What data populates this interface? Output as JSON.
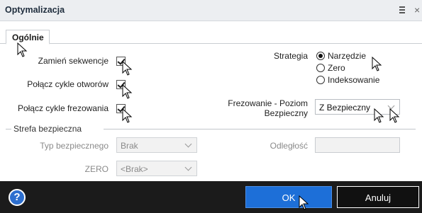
{
  "window": {
    "title": "Optymalizacja",
    "close_glyph": "×"
  },
  "tabs": [
    {
      "label": "Ogólnie",
      "active": true
    }
  ],
  "options": {
    "swap_sequences": {
      "label": "Zamień sekwencje",
      "checked": true
    },
    "join_hole_cycles": {
      "label": "Połącz cykle otworów",
      "checked": true
    },
    "join_milling_cycles": {
      "label": "Połącz cykle frezowania",
      "checked": true
    }
  },
  "strategy": {
    "label": "Strategia",
    "options": [
      {
        "label": "Narzędzie",
        "selected": true
      },
      {
        "label": "Zero",
        "selected": false
      },
      {
        "label": "Indeksowanie",
        "selected": false
      }
    ]
  },
  "milling_level": {
    "label_line1": "Frezowanie - Poziom",
    "label_line2": "Bezpieczny",
    "value": "Z Bezpieczny"
  },
  "safe_zone": {
    "legend": "Strefa bezpieczna",
    "type_label": "Typ bezpiecznego",
    "type_value": "Brak",
    "distance_label": "Odległość",
    "distance_value": "",
    "zero_label": "ZERO",
    "zero_value": "<Brak>"
  },
  "footer": {
    "help_glyph": "?",
    "ok_label": "OK",
    "cancel_label": "Anuluj"
  },
  "colors": {
    "accent": "#1d6fd8",
    "footer_bg": "#1b1b1b",
    "titlebar_bg": "#eceef1"
  },
  "icons": [
    "menu-icon",
    "close-icon",
    "help-icon",
    "dropdown-chevron-icon",
    "mouse-cursor-icon"
  ]
}
